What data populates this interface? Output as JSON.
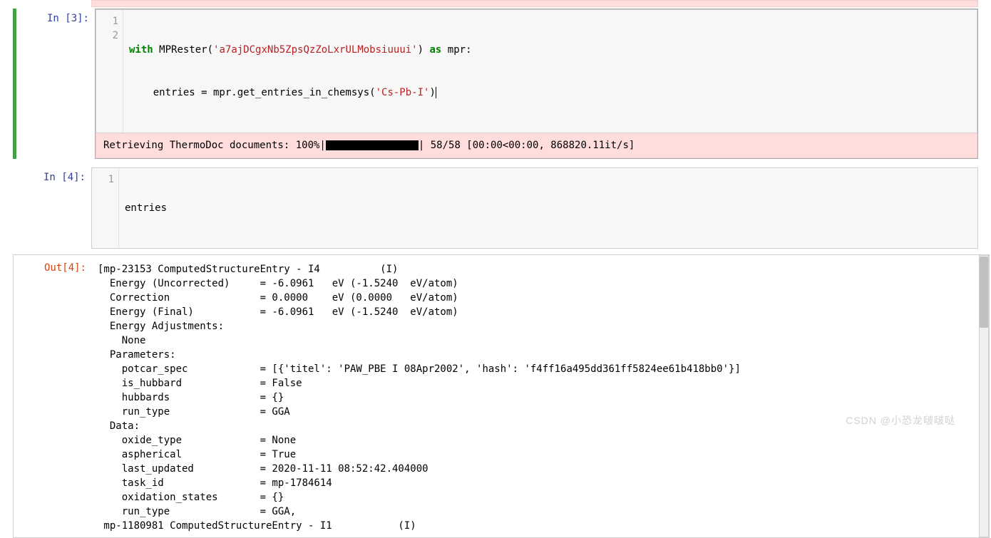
{
  "cell3": {
    "prompt_label": "In [3]:",
    "line1_nums": "1",
    "line2_nums": "2",
    "code": {
      "w": "with",
      "mprester": "MPRester",
      "api_key": "'a7ajDCgxNb5ZpsQzZoLxrULMobsiuuui'",
      "as": "as",
      "mpr": "mpr",
      "colon": ":",
      "indent": "    entries = mpr.get_entries_in_chemsys",
      "arg": "'Cs-Pb-I'"
    },
    "stderr": {
      "prefix": "Retrieving ThermoDoc documents: 100%|",
      "suffix": "| 58/58 [00:00<00:00, 868820.11it/s]"
    }
  },
  "cell4": {
    "prompt_label": "In [4]:",
    "line1_nums": "1",
    "code": "entries"
  },
  "out4": {
    "prompt_label": "Out[4]:",
    "text": "[mp-23153 ComputedStructureEntry - I4          (I)\n  Energy (Uncorrected)     = -6.0961   eV (-1.5240  eV/atom)\n  Correction               = 0.0000    eV (0.0000   eV/atom)\n  Energy (Final)           = -6.0961   eV (-1.5240  eV/atom)\n  Energy Adjustments:\n    None\n  Parameters:\n    potcar_spec            = [{'titel': 'PAW_PBE I 08Apr2002', 'hash': 'f4ff16a495dd361ff5824ee61b418bb0'}]\n    is_hubbard             = False\n    hubbards               = {}\n    run_type               = GGA\n  Data:\n    oxide_type             = None\n    aspherical             = True\n    last_updated           = 2020-11-11 08:52:42.404000\n    task_id                = mp-1784614\n    oxidation_states       = {}\n    run_type               = GGA,\n mp-1180981 ComputedStructureEntry - I1           (I)"
  },
  "watermark": "CSDN @小恐龙啵啵哒"
}
